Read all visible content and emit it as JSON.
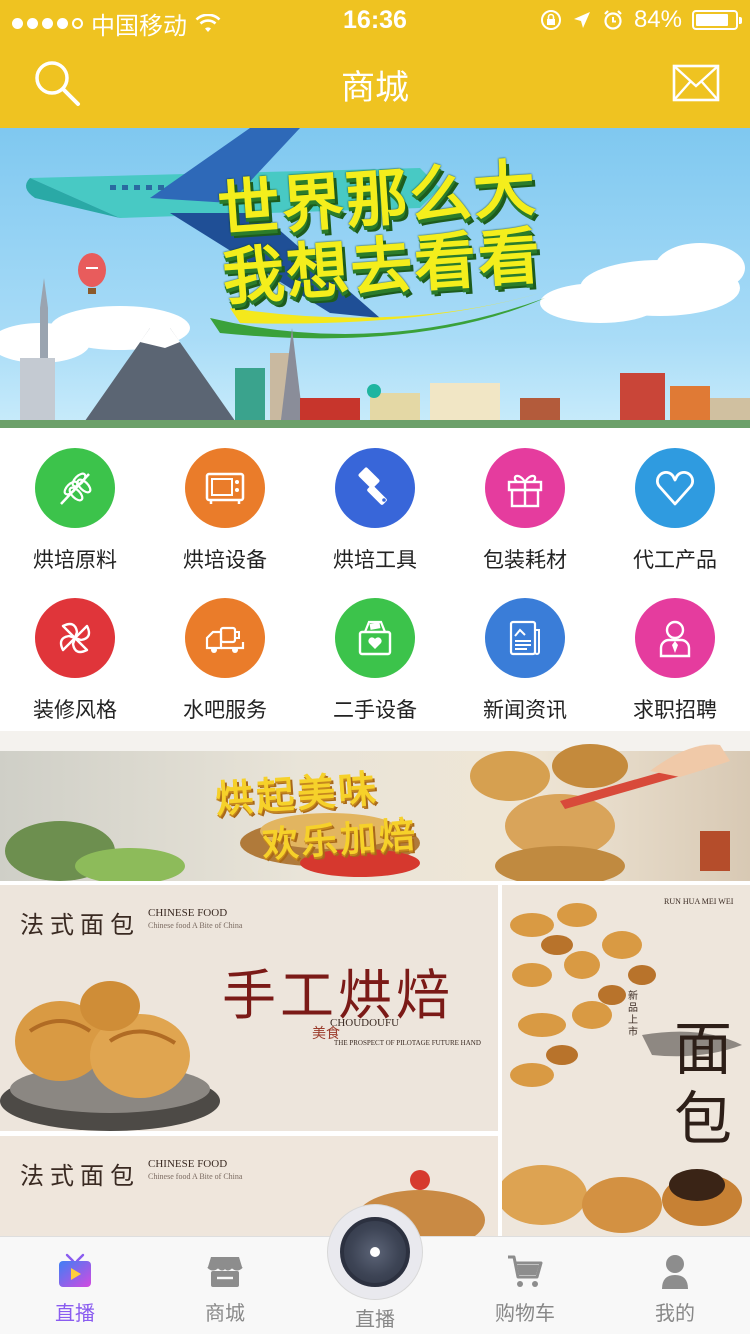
{
  "status_bar": {
    "carrier": "中国移动",
    "time": "16:36",
    "battery": "84%",
    "battery_level": 0.84
  },
  "header": {
    "title": "商城"
  },
  "hero_banner": {
    "title_line1": "世界那么大",
    "title_line2": "我想去看看"
  },
  "categories": [
    {
      "label": "烘培原料",
      "icon": "wheat-icon",
      "color": "#3CC34B"
    },
    {
      "label": "烘培设备",
      "icon": "oven-icon",
      "color": "#EA7C2A"
    },
    {
      "label": "烘培工具",
      "icon": "tool-icon",
      "color": "#3866D9"
    },
    {
      "label": "包装耗材",
      "icon": "gift-icon",
      "color": "#E53C9E"
    },
    {
      "label": "代工产品",
      "icon": "heart-icon",
      "color": "#2F9BE0"
    },
    {
      "label": "装修风格",
      "icon": "pinwheel-icon",
      "color": "#E0353A"
    },
    {
      "label": "水吧服务",
      "icon": "truck-icon",
      "color": "#EA7C2A"
    },
    {
      "label": "二手设备",
      "icon": "basket-icon",
      "color": "#3CC34B"
    },
    {
      "label": "新闻资讯",
      "icon": "news-icon",
      "color": "#3A7DD8"
    },
    {
      "label": "求职招聘",
      "icon": "person-icon",
      "color": "#E53C9E"
    }
  ],
  "bakery_banner": {
    "line1": "烘起美味",
    "line2": "欢乐加焙"
  },
  "tiles": {
    "bread1": {
      "brand": "法式面包",
      "sub1": "CHINESE FOOD",
      "sub2": "Chinese food A Bite of China",
      "headline": "手工烘焙",
      "tag": "美食",
      "caption": "THE PROSPECT OF PILOTAGE FUTURE HAND",
      "logo": "CHOUDOUFU"
    },
    "bread2": {
      "brand": "法式面包",
      "sub1": "CHINESE FOOD",
      "sub2": "Chinese food A Bite of China"
    },
    "side": {
      "headline": "面包",
      "top_text": "RUN HUA MEI WEI",
      "stamp": "新品上市"
    }
  },
  "tabbar": {
    "items": [
      {
        "label": "直播",
        "active": true
      },
      {
        "label": "商城",
        "active": false
      },
      {
        "label": "直播",
        "active": false
      },
      {
        "label": "购物车",
        "active": false
      },
      {
        "label": "我的",
        "active": false
      }
    ]
  },
  "colors": {
    "header_bg": "#EFC321",
    "tab_active": "#8A5CF0"
  }
}
